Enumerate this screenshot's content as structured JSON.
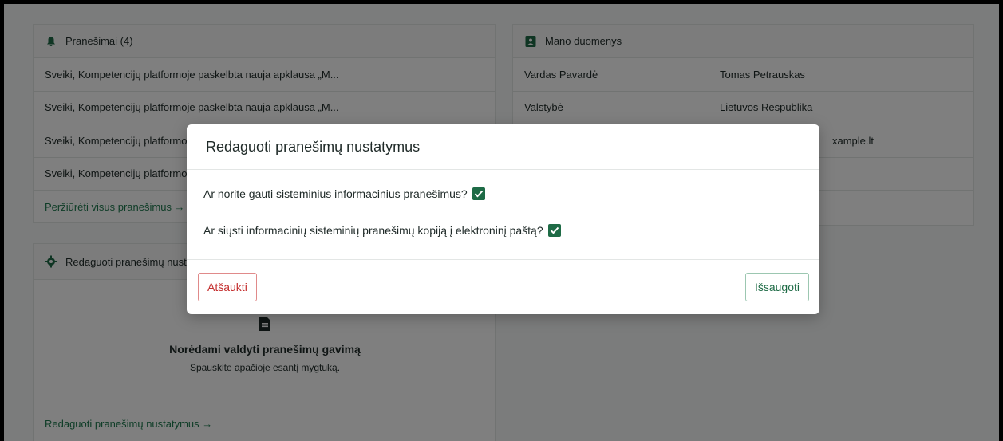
{
  "notifications": {
    "header": "Pranešimai (4)",
    "items": [
      "Sveiki, Kompetencijų platformoje paskelbta nauja apklausa „M...",
      "Sveiki, Kompetencijų platformoje paskelbta nauja apklausa „M...",
      "Sveiki, Kompetencijų platformoje paskelbta nauja apklausa „M...",
      "Sveiki, Kompetencijų platformoje paskelbta nauja apklausa „M..."
    ],
    "view_all": "Peržiūrėti visus pranešimus →"
  },
  "settings_card": {
    "header": "Redaguoti pranešimų nustatymus",
    "title": "Norėdami valdyti pranešimų gavimą",
    "subtitle": "Spauskite apačioje esantį mygtuką.",
    "link": "Redaguoti pranešimų nustatymus →"
  },
  "profile": {
    "header": "Mano duomenys",
    "rows": [
      {
        "k": "Vardas Pavardė",
        "v": "Tomas Petrauskas"
      },
      {
        "k": "Valstybė",
        "v": "Lietuvos Respublika"
      },
      {
        "k": "",
        "v": "xample.lt"
      },
      {
        "k": "",
        "v": ""
      },
      {
        "k": "",
        "v": ""
      }
    ]
  },
  "modal": {
    "title": "Redaguoti pranešimų nustatymus",
    "q1": "Ar norite gauti sisteminius informacinius pranešimus?",
    "q1_checked": true,
    "q2": "Ar siųsti informacinių sisteminių pranešimų kopiją į elektroninį paštą?",
    "q2_checked": true,
    "cancel": "Atšaukti",
    "save": "Išsaugoti"
  },
  "colors": {
    "accent": "#1e6b46",
    "link": "#1e7a4f",
    "cancel": "#c53030"
  },
  "icons": {
    "notifications": "bell-icon",
    "settings": "gear-icon",
    "profile": "id-card-icon",
    "document": "document-icon",
    "check": "check-icon"
  }
}
